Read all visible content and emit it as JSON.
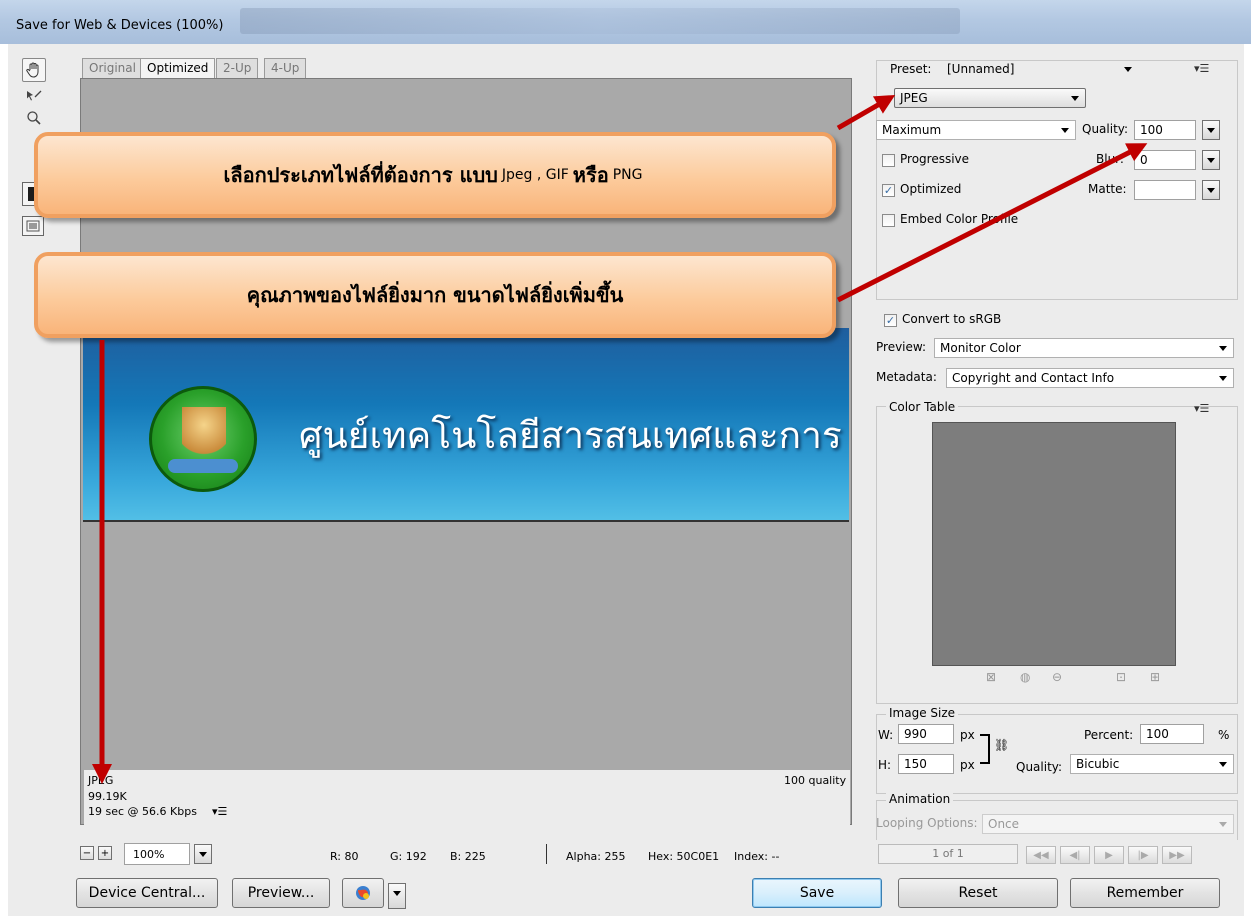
{
  "window": {
    "title": "Save for Web & Devices (100%)"
  },
  "tools": [
    {
      "icon": "hand-tool-icon"
    },
    {
      "icon": "slice-select-tool-icon"
    },
    {
      "icon": "zoom-tool-icon"
    },
    {
      "icon": "eyedropper-color-icon"
    },
    {
      "icon": "toggle-slices-icon"
    }
  ],
  "tabs": [
    {
      "label": "Original"
    },
    {
      "label": "Optimized"
    },
    {
      "label": "2-Up"
    },
    {
      "label": "4-Up"
    }
  ],
  "active_tab": "Optimized",
  "banner": {
    "text": "ศูนย์เทคโนโลยีสารสนเทศและการ"
  },
  "view_info": {
    "format": "JPEG",
    "size": "99.19K",
    "time": "19 sec @ 56.6 Kbps",
    "quality": "100 quality"
  },
  "status": {
    "zoom": "100%",
    "r": "R: 80",
    "g": "G: 192",
    "b": "B: 225",
    "alpha": "Alpha: 255",
    "hex": "Hex: 50C0E1",
    "index": "Index: --"
  },
  "buttons": {
    "device_central": "Device Central...",
    "preview": "Preview...",
    "save": "Save",
    "reset": "Reset",
    "remember": "Remember"
  },
  "settings": {
    "preset_label": "Preset:",
    "preset_value": "[Unnamed]",
    "format": "JPEG",
    "compression": "Maximum",
    "quality_label": "Quality:",
    "quality_value": "100",
    "progressive": "Progressive",
    "blur_label": "Blur:",
    "blur_value": "0",
    "optimized": "Optimized",
    "matte_label": "Matte:",
    "embed_profile": "Embed Color Profile",
    "convert_srgb": "Convert to sRGB",
    "preview_label": "Preview:",
    "preview_value": "Monitor Color",
    "metadata_label": "Metadata:",
    "metadata_value": "Copyright and Contact Info"
  },
  "checks": {
    "progressive": false,
    "optimized": true,
    "embed_profile": false,
    "convert_srgb": true
  },
  "color_table": {
    "title": "Color Table"
  },
  "image_size": {
    "title": "Image Size",
    "w_label": "W:",
    "w_value": "990",
    "h_label": "H:",
    "h_value": "150",
    "unit": "px",
    "percent_label": "Percent:",
    "percent_value": "100",
    "percent_unit": "%",
    "quality_label": "Quality:",
    "quality_value": "Bicubic"
  },
  "animation": {
    "title": "Animation",
    "looping_label": "Looping Options:",
    "looping_value": "Once",
    "frame": "1 of 1"
  },
  "callouts": [
    {
      "part1": "เลือกประเภทไฟล์ที่ต้องการ แบบ",
      "part2": "Jpeg , GIF",
      "part3": "หรือ",
      "part4": "PNG"
    },
    {
      "text": "คุณภาพของไฟล์ยิ่งมาก ขนาดไฟล์ยิ่งเพิ่มขึ้น"
    }
  ],
  "colors": {
    "arrow": "#c00000",
    "callout_border": "#f0a060",
    "banner_top": "#1f5e9e",
    "banner_bottom": "#52bfe6"
  }
}
